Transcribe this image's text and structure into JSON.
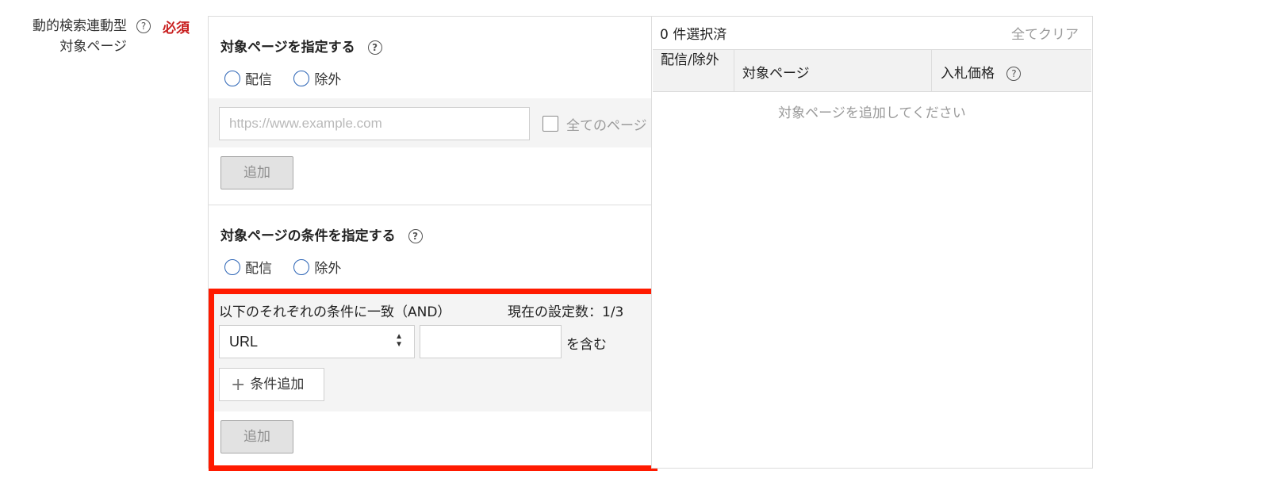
{
  "field": {
    "label_line1": "動的検索連動型",
    "label_line2": "対象ページ",
    "help_glyph": "?",
    "required": "必須"
  },
  "specify_pages": {
    "title": "対象ページを指定する",
    "radio_deliver": "配信",
    "radio_exclude": "除外",
    "url_placeholder": "https://www.example.com",
    "all_pages_label": "全てのページ",
    "add_button": "追加"
  },
  "specify_conditions": {
    "title": "対象ページの条件を指定する",
    "radio_deliver": "配信",
    "radio_exclude": "除外",
    "match_heading": "以下のそれぞれの条件に一致（AND）",
    "current_count": "現在の設定数：1/3",
    "condition_type": "URL",
    "condition_value": "",
    "contains_label": "を含む",
    "add_condition_button": "条件追加",
    "add_button": "追加"
  },
  "selected": {
    "count_label": "0 件選択済",
    "clear_all": "全てクリア",
    "columns": [
      "配信/除外",
      "対象ページ",
      "入札価格"
    ],
    "empty_message": "対象ページを追加してください"
  },
  "colors": {
    "highlight": "#ff1a00",
    "required": "#c81e1e",
    "radio": "#2a63b5"
  }
}
